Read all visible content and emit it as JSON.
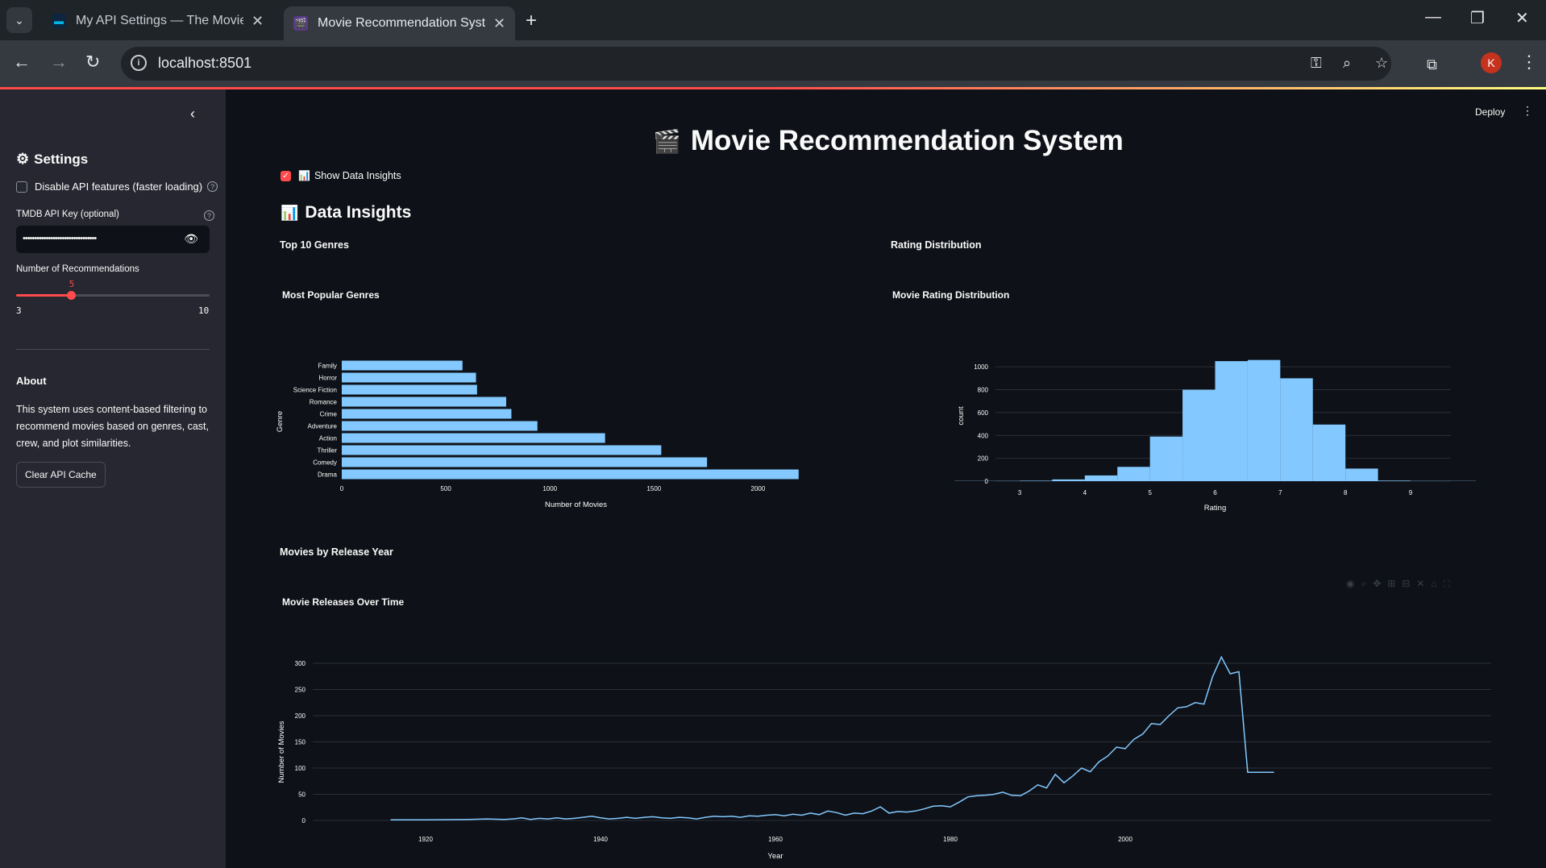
{
  "browser": {
    "tabs": [
      {
        "title": "My API Settings — The Movie D",
        "active": false
      },
      {
        "title": "Movie Recommendation System",
        "active": true
      }
    ],
    "url": "localhost:8501",
    "avatar_letter": "K"
  },
  "sidebar": {
    "settings_title": "Settings",
    "disable_api_label": "Disable API features (faster loading)",
    "api_key_label": "TMDB API Key (optional)",
    "api_key_value": "••••••••••••••••••••••••••••••••",
    "recs_label": "Number of Recommendations",
    "recs_value": "5",
    "recs_min": "3",
    "recs_max": "10",
    "recs_fraction": 0.2857,
    "about_title": "About",
    "about_text": "This system uses content-based filtering to recommend movies based on genres, cast, crew, and plot similarities.",
    "clear_cache_label": "Clear API Cache"
  },
  "main": {
    "deploy_label": "Deploy",
    "title": "Movie Recommendation System",
    "show_insights_label": "Show Data Insights",
    "insights_title": "Data Insights",
    "top_genres_sub": "Top 10 Genres",
    "rating_sub": "Rating Distribution",
    "year_sub": "Movies by Release Year"
  },
  "chart_data": [
    {
      "type": "bar",
      "orientation": "horizontal",
      "title": "Most Popular Genres",
      "xlabel": "Number of Movies",
      "ylabel": "Genre",
      "categories": [
        "Family",
        "Horror",
        "Science Fiction",
        "Romance",
        "Crime",
        "Adventure",
        "Action",
        "Thriller",
        "Comedy",
        "Drama"
      ],
      "values": [
        580,
        645,
        650,
        790,
        815,
        940,
        1265,
        1535,
        1755,
        2195
      ],
      "xlim": [
        0,
        2250
      ],
      "xticks": [
        0,
        500,
        1000,
        1500,
        2000
      ],
      "color": "#83c9ff"
    },
    {
      "type": "bar",
      "subtype": "histogram",
      "title": "Movie Rating Distribution",
      "xlabel": "Rating",
      "ylabel": "count",
      "bin_starts": [
        2.0,
        2.5,
        3.0,
        3.5,
        4.0,
        4.5,
        5.0,
        5.5,
        6.0,
        6.5,
        7.0,
        7.5,
        8.0,
        8.5,
        9.0,
        9.5
      ],
      "values": [
        2,
        2,
        4,
        15,
        50,
        125,
        390,
        800,
        1050,
        1060,
        900,
        495,
        110,
        5,
        2,
        2
      ],
      "bin_width": 0.5,
      "xlim": [
        1.7,
        9.5
      ],
      "ylim": [
        0,
        1100
      ],
      "xticks": [
        3,
        4,
        5,
        6,
        7,
        8,
        9
      ],
      "yticks": [
        0,
        200,
        400,
        600,
        800,
        1000
      ],
      "color": "#83c9ff"
    },
    {
      "type": "line",
      "title": "Movie Releases Over Time",
      "xlabel": "Year",
      "ylabel": "Number of Movies",
      "x": [
        1916,
        1920,
        1925,
        1927,
        1929,
        1930,
        1931,
        1932,
        1933,
        1934,
        1935,
        1936,
        1937,
        1938,
        1939,
        1940,
        1941,
        1942,
        1943,
        1944,
        1945,
        1946,
        1947,
        1948,
        1949,
        1950,
        1951,
        1952,
        1953,
        1954,
        1955,
        1956,
        1957,
        1958,
        1959,
        1960,
        1961,
        1962,
        1963,
        1964,
        1965,
        1966,
        1967,
        1968,
        1969,
        1970,
        1971,
        1972,
        1973,
        1974,
        1975,
        1976,
        1977,
        1978,
        1979,
        1980,
        1981,
        1982,
        1983,
        1984,
        1985,
        1986,
        1987,
        1988,
        1989,
        1990,
        1991,
        1992,
        1993,
        1994,
        1995,
        1996,
        1997,
        1998,
        1999,
        2000,
        2001,
        2002,
        2003,
        2004,
        2005,
        2006,
        2007,
        2008,
        2009,
        2010,
        2011,
        2012,
        2013,
        2014,
        2015,
        2016,
        2017
      ],
      "y": [
        1,
        1,
        2,
        3,
        2,
        3,
        5,
        2,
        4,
        3,
        5,
        3,
        4,
        6,
        8,
        5,
        3,
        4,
        6,
        4,
        6,
        7,
        5,
        4,
        6,
        5,
        3,
        6,
        8,
        7,
        8,
        6,
        9,
        8,
        10,
        11,
        9,
        12,
        10,
        14,
        11,
        18,
        15,
        10,
        14,
        13,
        18,
        26,
        14,
        17,
        16,
        18,
        22,
        27,
        28,
        26,
        35,
        45,
        47,
        48,
        50,
        54,
        48,
        47,
        56,
        68,
        62,
        88,
        72,
        85,
        100,
        93,
        112,
        123,
        140,
        137,
        155,
        165,
        185,
        183,
        200,
        215,
        217,
        225,
        222,
        275,
        312,
        280,
        284,
        92,
        92,
        92,
        92
      ],
      "xlim": [
        1915,
        2015
      ],
      "ylim": [
        0,
        320
      ],
      "xticks": [
        1920,
        1940,
        1960,
        1980,
        2000
      ],
      "yticks": [
        0,
        50,
        100,
        150,
        200,
        250,
        300
      ],
      "color": "#83c9ff"
    }
  ]
}
